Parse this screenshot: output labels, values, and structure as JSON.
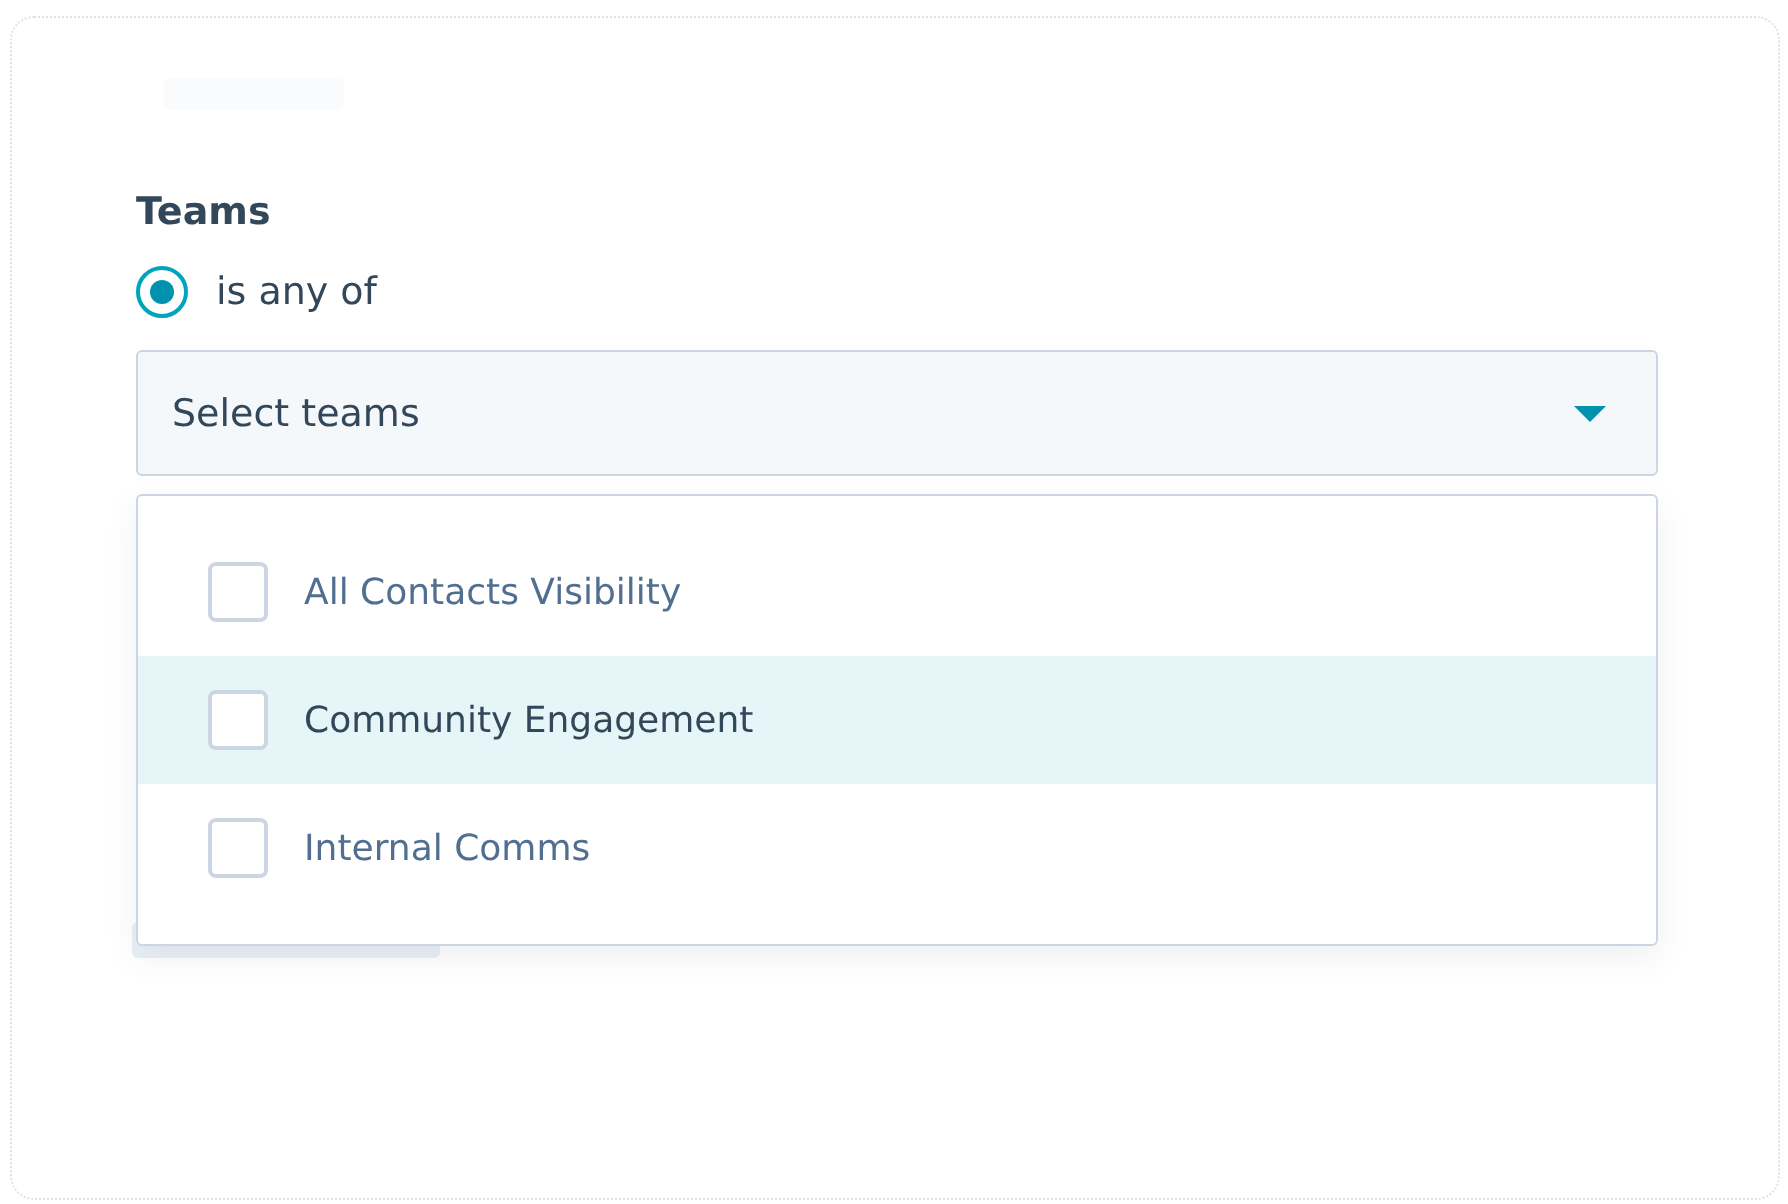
{
  "field_label": "Teams",
  "operator": {
    "label": "is any of",
    "selected": true
  },
  "select": {
    "placeholder": "Select teams",
    "expanded": true
  },
  "options": [
    {
      "label": "All Contacts Visibility",
      "checked": false,
      "highlighted": false
    },
    {
      "label": "Community Engagement",
      "checked": false,
      "highlighted": true
    },
    {
      "label": "Internal Comms",
      "checked": false,
      "highlighted": false
    }
  ]
}
